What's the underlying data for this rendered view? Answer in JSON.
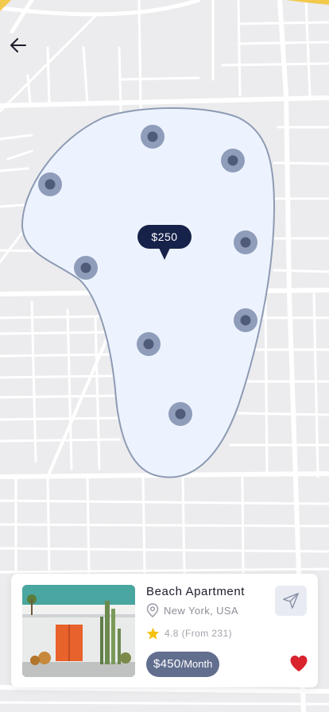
{
  "map": {
    "area_fill": "#edf3fe",
    "area_stroke": "#8d9bb4",
    "marker_outer": "#8f9cba",
    "marker_inner": "#4f5b79",
    "marker_count": 8,
    "selected_price": "$250",
    "selected_tag_color": "#17224a"
  },
  "nav": {
    "back_icon": "arrow-left-icon"
  },
  "listing": {
    "title": "Beach Apartment",
    "location": "New York, USA",
    "rating": "4.8",
    "rating_count": "(From 231)",
    "price": "$450",
    "price_period": "/Month",
    "favorite": true,
    "icons": [
      "location-pin-icon",
      "star-icon",
      "send-icon",
      "heart-icon"
    ],
    "accent_color": "#626e8e",
    "star_color": "#f4c20d",
    "heart_color": "#d9232d"
  }
}
